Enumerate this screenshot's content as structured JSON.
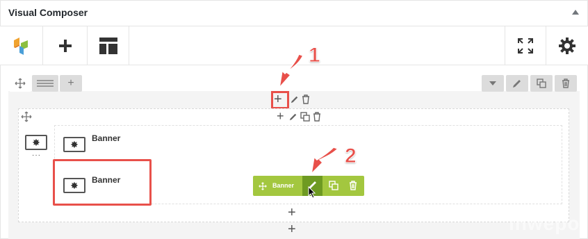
{
  "panel": {
    "title": "Visual Composer"
  },
  "row": {
    "element_1": {
      "label": "Banner"
    },
    "element_2": {
      "label": "Banner"
    },
    "active_control_label": "Banner"
  },
  "annotations": {
    "step1": "1",
    "step2": "2"
  },
  "watermark": "inwepo",
  "colors": {
    "accent_red": "#e8504a",
    "control_green": "#a3c73f",
    "control_green_dark": "#6e9a22",
    "logo_orange": "#f0a330",
    "logo_green": "#8cbf3f",
    "logo_blue": "#4a9fd8"
  },
  "icons": [
    "vc-logo-icon",
    "add-element-icon",
    "templates-icon",
    "fullscreen-icon",
    "settings-gear-icon",
    "move-icon",
    "layout-icon",
    "plus-icon",
    "chevron-down-icon",
    "edit-pencil-icon",
    "clone-icon",
    "trash-icon",
    "banner-element-icon",
    "mouse-cursor-icon",
    "red-arrow-icon"
  ]
}
